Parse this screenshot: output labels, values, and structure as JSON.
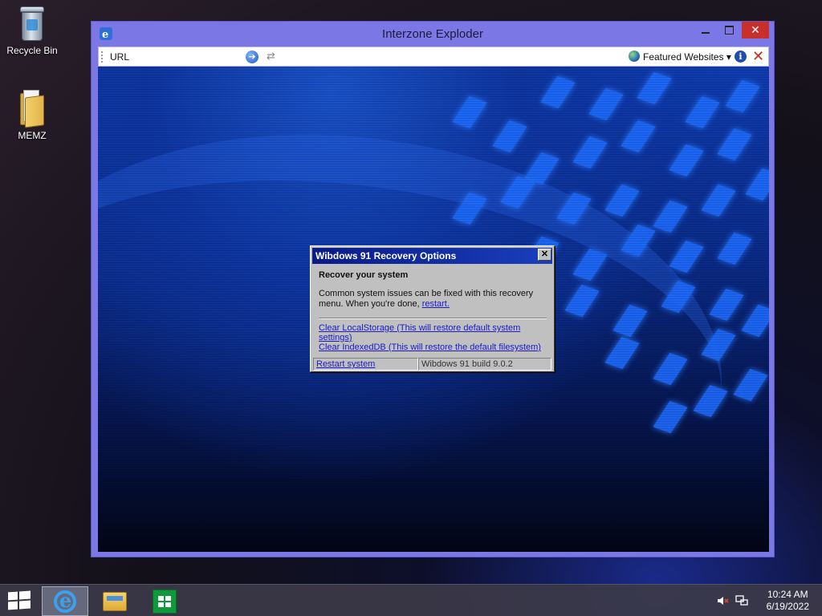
{
  "desktop": {
    "icons": [
      {
        "label": "Recycle Bin",
        "icon": "recycle-bin-icon"
      },
      {
        "label": "MEMZ",
        "icon": "folder-icon"
      }
    ]
  },
  "window": {
    "title": "Interzone Exploder",
    "toolbar": {
      "url_label": "URL",
      "go_icon": "go-arrow-icon",
      "refresh_icon": "refresh-icon",
      "featured_label": "Featured Websites",
      "featured_arrow": "▾",
      "info_icon": "info-icon",
      "stop_icon": "stop-icon"
    }
  },
  "dialog": {
    "title": "Wibdows 91 Recovery Options",
    "close_glyph": "✕",
    "heading": "Recover your system",
    "description": "Common system issues can be fixed with this recovery menu. When you're done, ",
    "restart_link": "restart.",
    "option1": "Clear LocalStorage (This will restore default system settings)",
    "option2": "Clear IndexedDB (This will restore the default filesystem)",
    "status_link": "Restart system",
    "status_build": "Wibdows 91 build 9.0.2"
  },
  "taskbar": {
    "items": [
      "start-icon",
      "internet-explorer-icon",
      "file-explorer-icon",
      "store-icon"
    ],
    "tray": {
      "time": "10:24 AM",
      "date": "6/19/2022"
    }
  },
  "colors": {
    "window_frame": "#7b78e6",
    "dialog_title": "#0a1a8a",
    "close_button": "#c9302c",
    "link": "#1a1ac8"
  }
}
